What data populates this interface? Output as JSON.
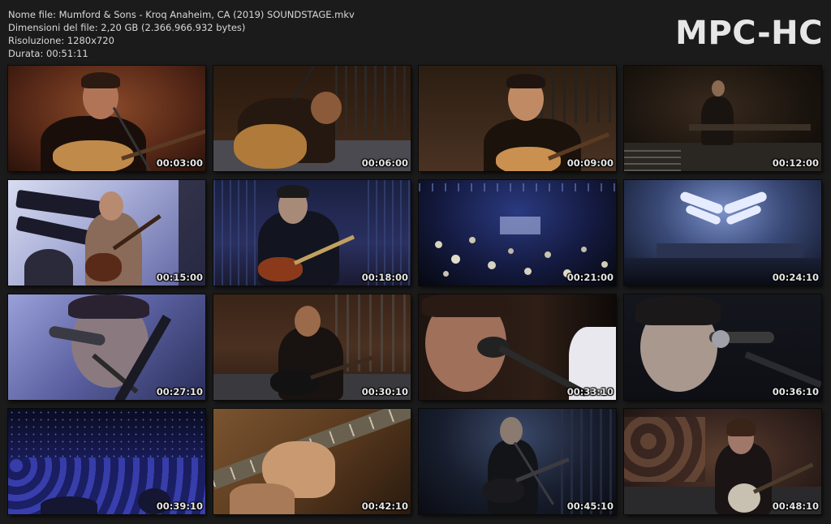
{
  "file_info": {
    "name": "Nome file: Mumford & Sons - Kroq Anaheim, CA (2019) SOUNDSTAGE.mkv",
    "size": "Dimensioni del file: 2,20 GB (2.366.966.932 bytes)",
    "resolution": "Risoluzione: 1280x720",
    "duration": "Durata: 00:51:11"
  },
  "logo": "MPC-HC",
  "thumbnails": [
    {
      "time": "00:03:00"
    },
    {
      "time": "00:06:00"
    },
    {
      "time": "00:09:00"
    },
    {
      "time": "00:12:00"
    },
    {
      "time": "00:15:00"
    },
    {
      "time": "00:18:00"
    },
    {
      "time": "00:21:00"
    },
    {
      "time": "00:24:10"
    },
    {
      "time": "00:27:10"
    },
    {
      "time": "00:30:10"
    },
    {
      "time": "00:33:10"
    },
    {
      "time": "00:36:10"
    },
    {
      "time": "00:39:10"
    },
    {
      "time": "00:42:10"
    },
    {
      "time": "00:45:10"
    },
    {
      "time": "00:48:10"
    }
  ]
}
